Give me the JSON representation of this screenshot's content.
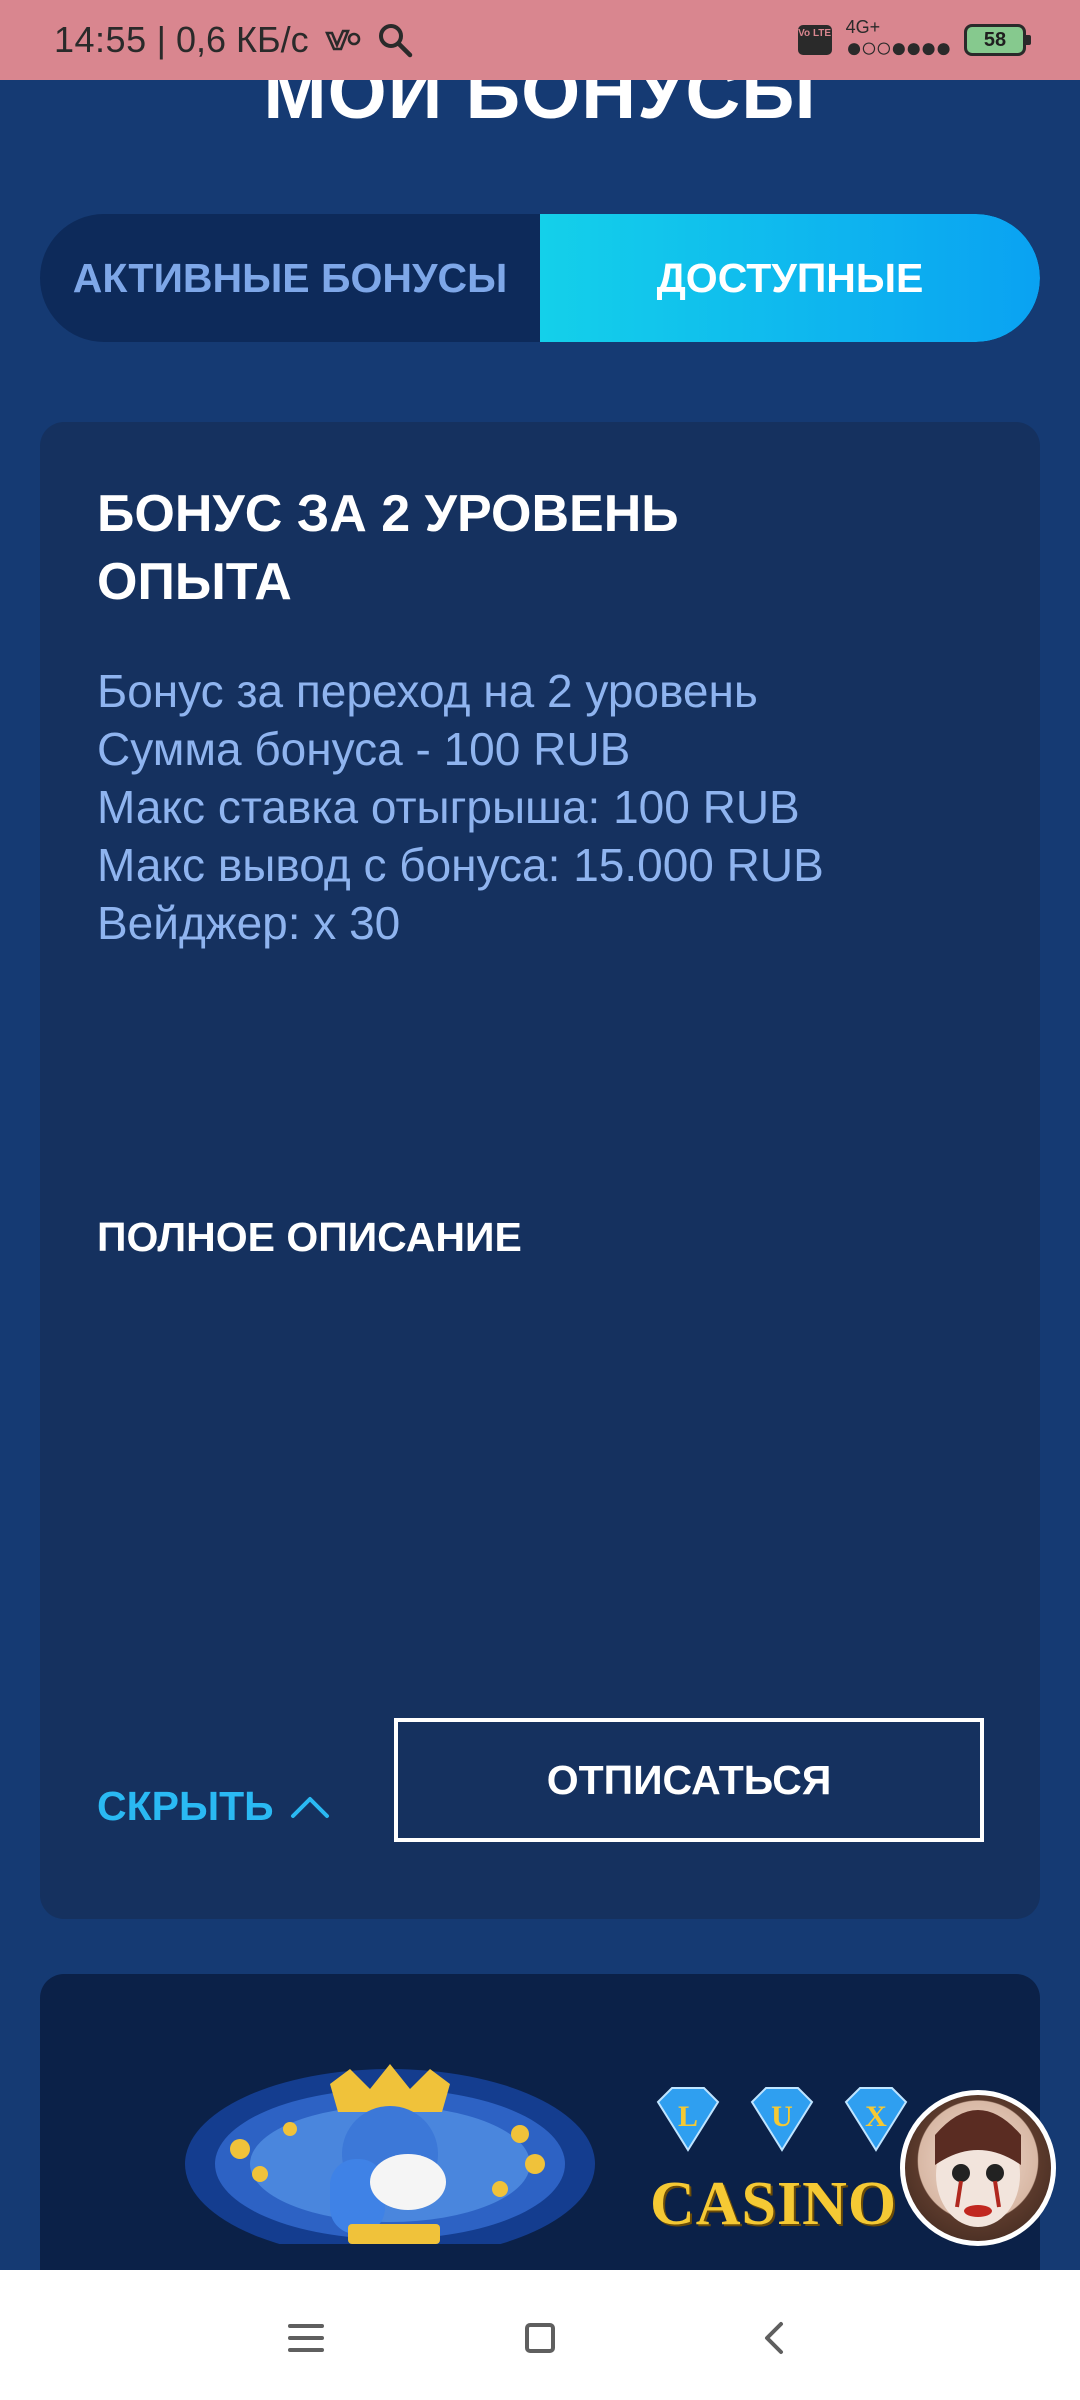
{
  "status_bar": {
    "time": "14:55",
    "separator": "|",
    "speed": "0,6 КБ/с",
    "network": "4G+",
    "volte": "Vo LTE",
    "battery": "58"
  },
  "page": {
    "title": "МОИ БОНУСЫ"
  },
  "tabs": [
    {
      "label": "АКТИВНЫЕ БОНУСЫ",
      "active": false
    },
    {
      "label": "ДОСТУПНЫЕ",
      "active": true
    }
  ],
  "bonus": {
    "title_line1": "БОНУС ЗА 2 УРОВЕНЬ",
    "title_line2": "ОПЫТА",
    "description": [
      "Бонус за переход на 2 уровень",
      "Сумма бонуса - 100 RUB",
      "Макс ставка отыгрыша: 100 RUB",
      "Макс вывод с бонуса: 15.000 RUB",
      "Вейджер: x 30"
    ],
    "full_description_label": "ПОЛНОЕ ОПИСАНИЕ",
    "hide_label": "СКРЫТЬ",
    "unsubscribe_label": "ОТПИСАТЬСЯ"
  },
  "promo": {
    "logo_letters": [
      "L",
      "U",
      "X"
    ],
    "logo_text": "CASINO"
  },
  "colors": {
    "background": "#153a73",
    "card": "#15315f",
    "accent": "#2ab9f3",
    "tab_active_start": "#14d0ea",
    "tab_active_end": "#0aa2f2",
    "muted_text": "#8fb4ef",
    "status_bar": "#d9868f"
  },
  "icons": {
    "status": [
      "vk-icon",
      "search-icon",
      "volte-icon",
      "signal-icon",
      "battery-icon"
    ],
    "nav": [
      "menu-icon",
      "home-icon",
      "back-icon"
    ]
  }
}
